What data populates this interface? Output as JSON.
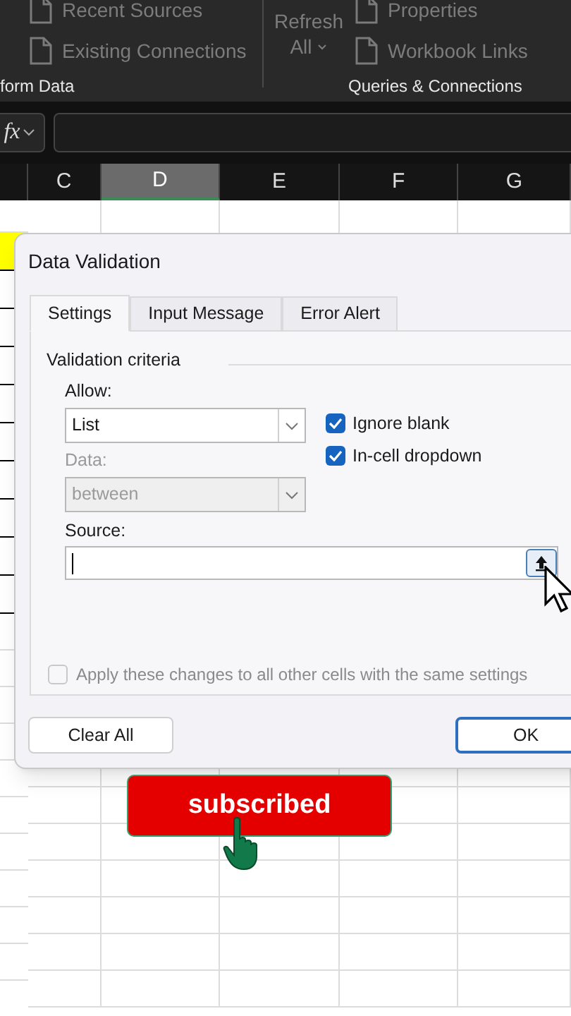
{
  "ribbon": {
    "left_items": [
      {
        "label": "Recent Sources"
      },
      {
        "label": "Existing Connections"
      }
    ],
    "left_group_label": "form Data",
    "refresh_button": {
      "line_1": "Refresh",
      "line_2": "All"
    },
    "right_items": [
      {
        "label": "Properties"
      },
      {
        "label": "Workbook Links"
      }
    ],
    "right_group_label": "Queries & Connections"
  },
  "formula_bar": {
    "fx_label": "fx"
  },
  "column_headers": [
    {
      "label": "C",
      "selected": false
    },
    {
      "label": "D",
      "selected": true
    },
    {
      "label": "E",
      "selected": false
    },
    {
      "label": "F",
      "selected": false
    },
    {
      "label": "G",
      "selected": false
    }
  ],
  "left_cells": [
    {
      "highlighted": true
    },
    {
      "highlighted": false
    },
    {
      "highlighted": false
    },
    {
      "highlighted": false
    },
    {
      "highlighted": false
    },
    {
      "highlighted": false
    },
    {
      "highlighted": false
    },
    {
      "highlighted": false
    },
    {
      "highlighted": false
    },
    {
      "highlighted": false
    }
  ],
  "dialog": {
    "title": "Data Validation",
    "tabs": [
      {
        "label": "Settings",
        "selected": true
      },
      {
        "label": "Input Message",
        "selected": false
      },
      {
        "label": "Error Alert",
        "selected": false
      }
    ],
    "section_title": "Validation criteria",
    "allow": {
      "label": "Allow:",
      "value": "List"
    },
    "data": {
      "label": "Data:",
      "value": "between",
      "disabled": true
    },
    "options": [
      {
        "label": "Ignore blank",
        "checked": true
      },
      {
        "label": "In-cell dropdown",
        "checked": true
      }
    ],
    "source": {
      "label": "Source:"
    },
    "apply": {
      "label": "Apply these changes to all other cells with the same settings",
      "checked": false,
      "disabled": true
    },
    "buttons": [
      {
        "label": "Clear All"
      },
      {
        "label": "OK"
      }
    ]
  },
  "subscribe_button": {
    "label": "subscribed"
  }
}
